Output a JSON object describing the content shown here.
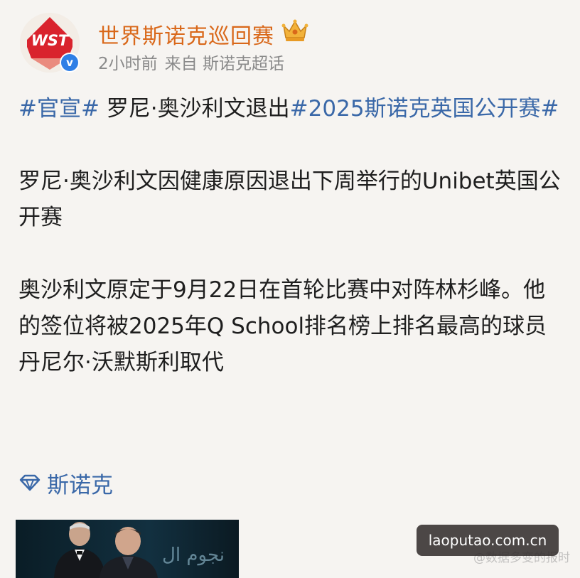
{
  "post": {
    "author": {
      "name": "世界斯诺克巡回赛",
      "avatar_logo_text": "WST",
      "verified_mark": "v",
      "badge_icon": "crown-icon"
    },
    "meta": {
      "time": "2小时前",
      "source": "来自 斯诺克超话"
    },
    "headline": {
      "tag1": "#官宣#",
      "text": " 罗尼·奥沙利文退出",
      "tag2": "#2025斯诺克英国公开赛#"
    },
    "paragraph1": "罗尼·奥沙利文因健康原因退出下周举行的Unibet英国公开赛",
    "paragraph2": "奥沙利文原定于9月22日在首轮比赛中对阵林杉峰。他的签位将被2025年Q School排名榜上排名最高的球员丹尼尔·沃默斯利取代",
    "topic": {
      "icon": "diamond-icon",
      "label": "斯诺克"
    },
    "photo": {
      "overlay_text": "نجوم ال"
    }
  },
  "watermark": {
    "faint_text": "@数据多变的报时",
    "badge_text": "laoputao.com.cn"
  },
  "colors": {
    "background": "#f6f4f1",
    "author_name": "#d9681a",
    "hashtag_link": "#3a68a8",
    "meta_text": "#8a8a8a",
    "logo_red": "#d9232d",
    "verified_blue": "#2f7fe6"
  }
}
